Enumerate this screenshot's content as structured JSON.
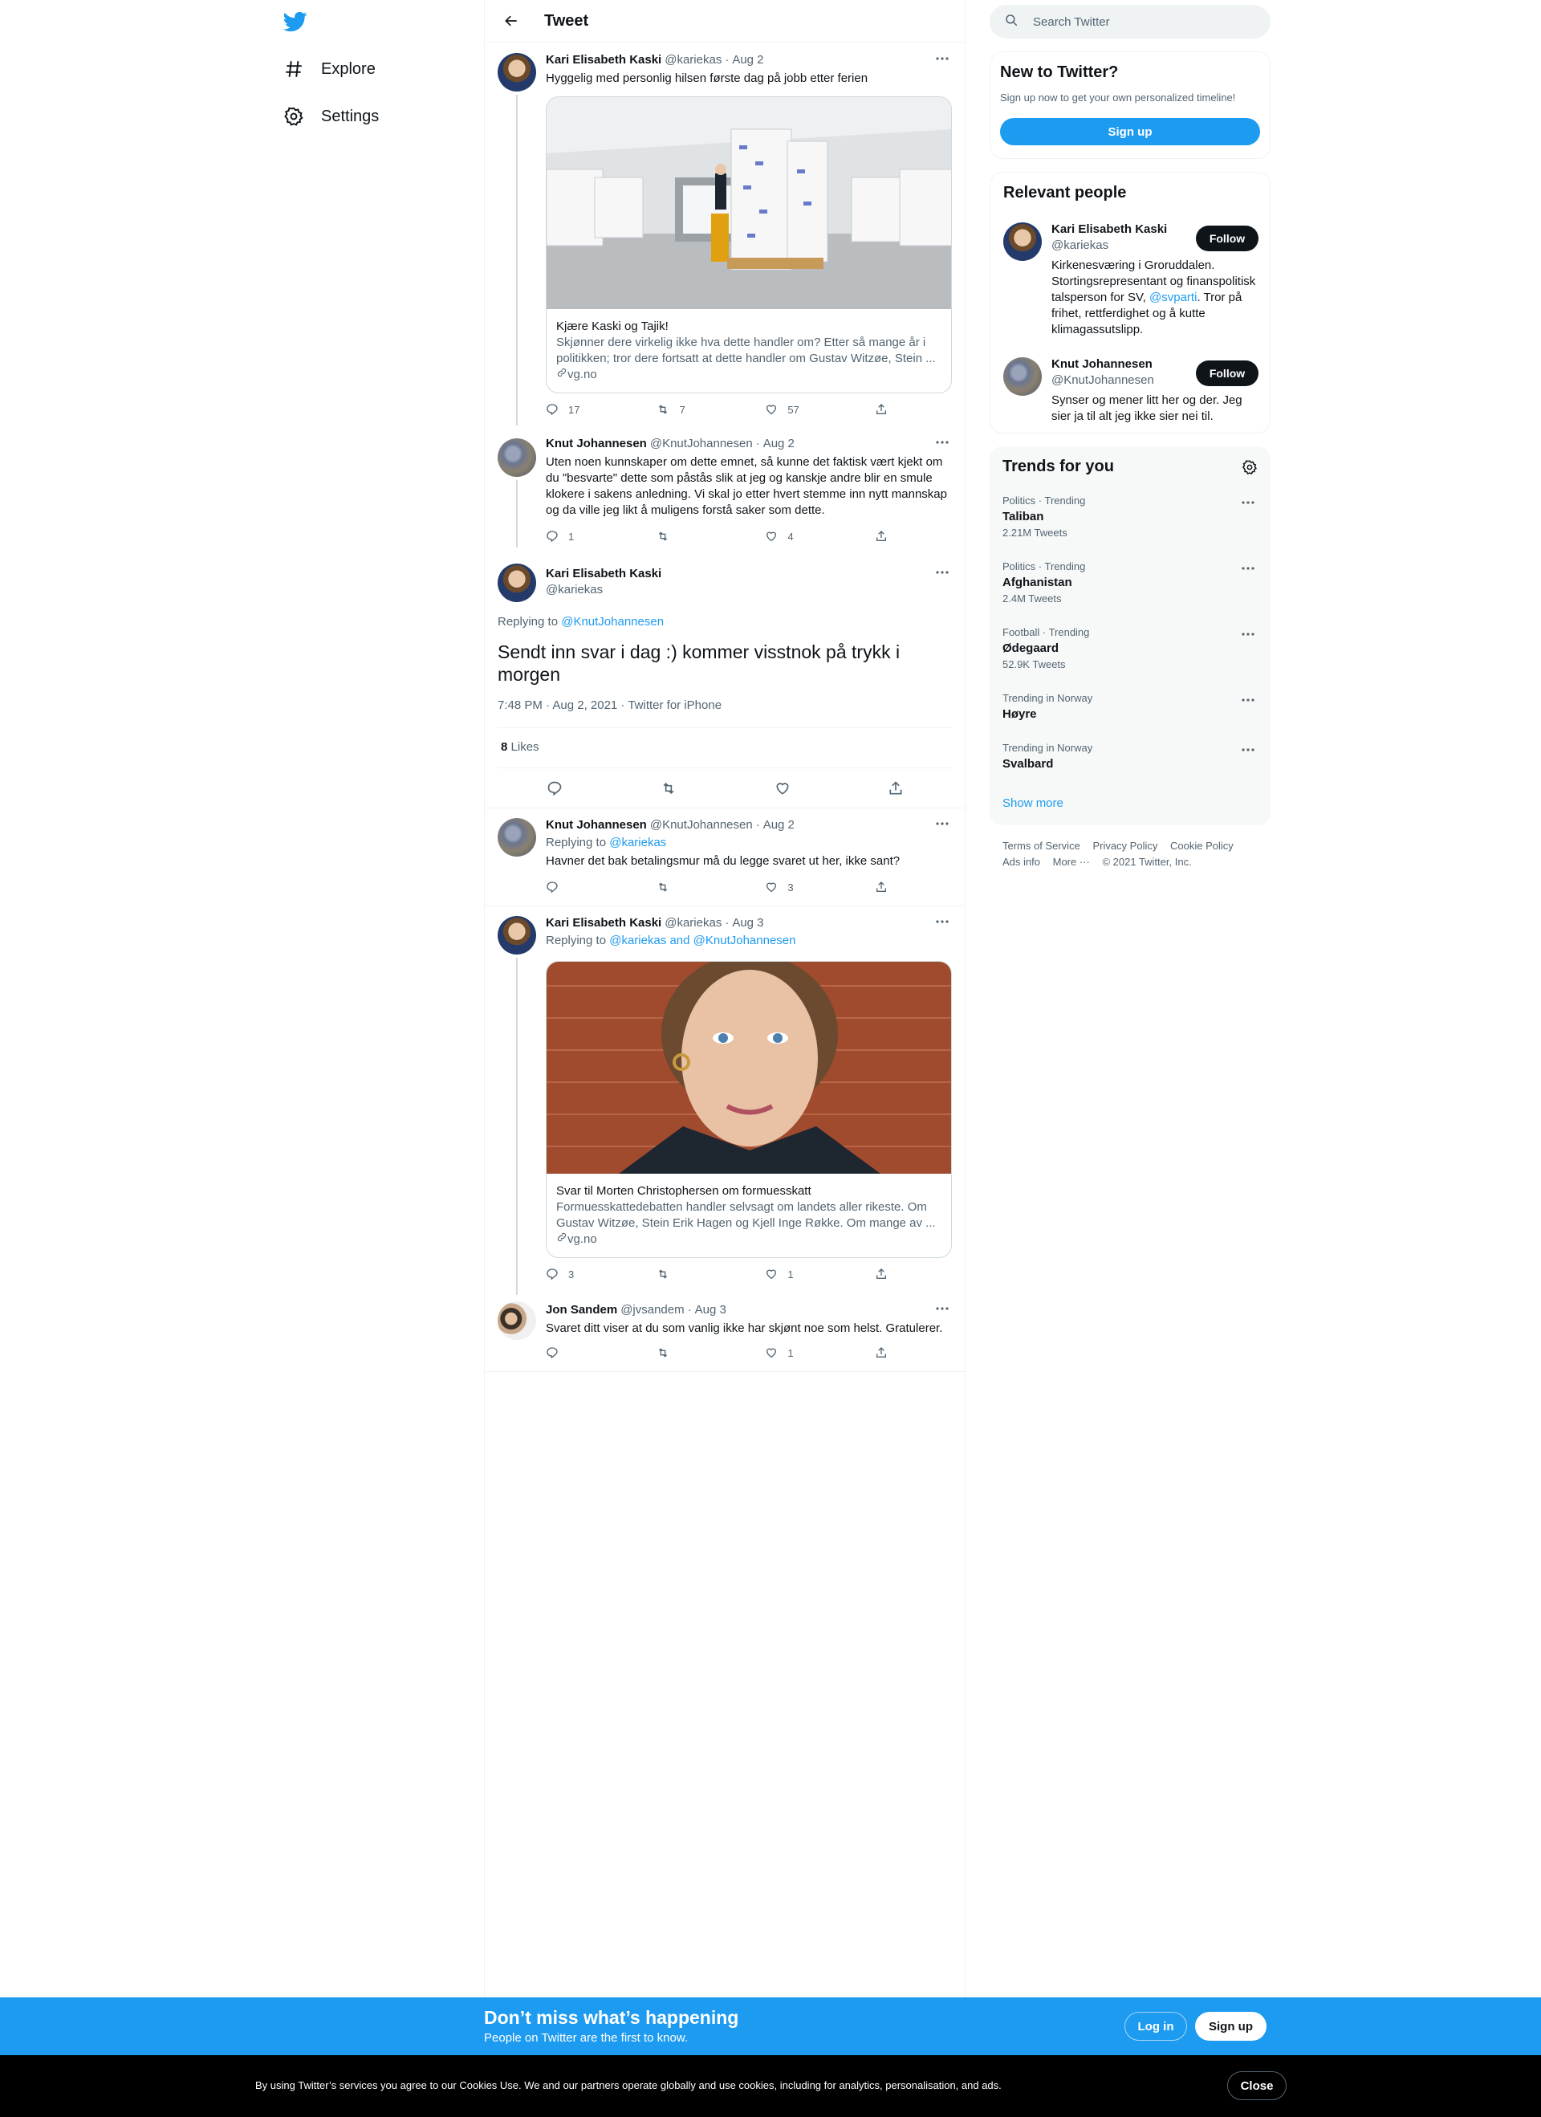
{
  "nav": {
    "items": [
      {
        "label": "Explore",
        "icon": "hashtag-icon"
      },
      {
        "label": "Settings",
        "icon": "gear-icon"
      }
    ]
  },
  "header": {
    "title": "Tweet"
  },
  "thread": {
    "t1": {
      "name": "Kari Elisabeth Kaski",
      "handle": "@kariekas",
      "date": "Aug 2",
      "text": "Hyggelig med personlig hilsen første dag på jobb etter ferien",
      "card": {
        "title": "Kjære Kaski og Tajik!",
        "desc": "Skjønner dere virkelig ikke hva dette handler om? Etter så mange år i politikken; tror dere fortsatt at dette handler om Gustav Witzøe, Stein ...",
        "domain": "vg.no"
      },
      "replies": "17",
      "retweets": "7",
      "likes": "57"
    },
    "t2": {
      "name": "Knut Johannesen",
      "handle": "@KnutJohannesen",
      "date": "Aug 2",
      "text": "Uten noen kunnskaper om dette emnet, så kunne det faktisk vært kjekt om du \"besvarte\" dette som påstås slik at jeg og kanskje andre blir en smule klokere i sakens anledning. Vi skal jo etter hvert stemme inn nytt mannskap og da ville jeg likt å muligens forstå saker som dette.",
      "replies": "1",
      "likes": "4"
    },
    "focus": {
      "name": "Kari Elisabeth Kaski",
      "handle": "@kariekas",
      "replying_prefix": "Replying to",
      "replying_to": "@KnutJohannesen",
      "text": "Sendt inn svar i dag :) kommer visstnok på trykk i morgen",
      "meta": "7:48 PM · Aug 2, 2021 · Twitter for iPhone",
      "likes_count": "8",
      "likes_label": "Likes"
    },
    "t4": {
      "name": "Knut Johannesen",
      "handle": "@KnutJohannesen",
      "date": "Aug 2",
      "replying_prefix": "Replying to",
      "replying_to": "@kariekas",
      "text": "Havner det bak betalingsmur må du legge svaret ut her, ikke sant?",
      "likes": "3"
    },
    "t5": {
      "name": "Kari Elisabeth Kaski",
      "handle": "@kariekas",
      "date": "Aug 3",
      "replying_prefix": "Replying to",
      "replying_to": "@kariekas and @KnutJohannesen",
      "card": {
        "title": "Svar til Morten Christophersen om formuesskatt",
        "desc": "Formuesskattedebatten handler selvsagt om landets aller rikeste. Om Gustav Witzøe, Stein Erik Hagen og Kjell Inge Røkke. Om mange av ...",
        "domain": "vg.no"
      },
      "replies": "3",
      "likes": "1"
    },
    "t6": {
      "name": "Jon Sandem",
      "handle": "@jvsandem",
      "date": "Aug 3",
      "text": "Svaret ditt viser at du som vanlig ikke har skjønt noe som helst. Gratulerer.",
      "likes": "1"
    }
  },
  "search": {
    "placeholder": "Search Twitter"
  },
  "new_to_twitter": {
    "title": "New to Twitter?",
    "sub": "Sign up now to get your own personalized timeline!",
    "button": "Sign up"
  },
  "relevant": {
    "title": "Relevant people",
    "people": [
      {
        "name": "Kari Elisabeth Kaski",
        "handle": "@kariekas",
        "bio_a": "Kirkenesværing i Groruddalen. Stortingsrepresentant og finanspolitisk talsperson for SV, ",
        "bio_link": "@svparti",
        "bio_b": ". Tror på frihet, rettferdighet og å kutte klimagassutslipp.",
        "follow": "Follow"
      },
      {
        "name": "Knut Johannesen",
        "handle": "@KnutJohannesen",
        "bio": "Synser og mener litt her og der. Jeg sier ja til alt jeg ikke sier nei til.",
        "follow": "Follow"
      }
    ]
  },
  "trends": {
    "title": "Trends for you",
    "items": [
      {
        "context": "Politics · Trending",
        "name": "Taliban",
        "count": "2.21M Tweets"
      },
      {
        "context": "Politics · Trending",
        "name": "Afghanistan",
        "count": "2.4M Tweets"
      },
      {
        "context": "Football · Trending",
        "name": "Ødegaard",
        "count": "52.9K Tweets"
      },
      {
        "context": "Trending in Norway",
        "name": "Høyre",
        "count": ""
      },
      {
        "context": "Trending in Norway",
        "name": "Svalbard",
        "count": ""
      }
    ],
    "show_more": "Show more"
  },
  "footer": {
    "terms": "Terms of Service",
    "privacy": "Privacy Policy",
    "cookie": "Cookie Policy",
    "ads": "Ads info",
    "more": "More ···",
    "copyright": "© 2021 Twitter, Inc."
  },
  "bottom_bar": {
    "title": "Don’t miss what’s happening",
    "sub": "People on Twitter are the first to know.",
    "login": "Log in",
    "signup": "Sign up"
  },
  "cookie_bar": {
    "text": "By using Twitter’s services you agree to our Cookies Use. We and our partners operate globally and use cookies, including for analytics, personalisation, and ads.",
    "close": "Close"
  },
  "colors": {
    "accent": "#1d9bf0",
    "text": "#0f1419",
    "muted": "#536471",
    "border": "#eff3f4"
  }
}
